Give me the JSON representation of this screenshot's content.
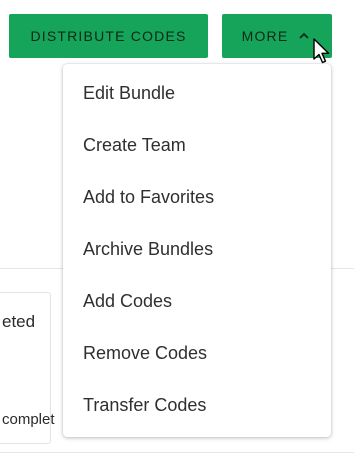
{
  "toolbar": {
    "distribute_label": "DISTRIBUTE CODES",
    "more_label": "MORE"
  },
  "background": {
    "status_text_1": "eted",
    "status_text_2": "complet"
  },
  "more_menu": {
    "items": [
      "Edit Bundle",
      "Create Team",
      "Add to Favorites",
      "Archive Bundles",
      "Add Codes",
      "Remove Codes",
      "Transfer Codes"
    ]
  },
  "icons": {
    "more_toggle": "chevron-up-icon",
    "pointer": "mouse-cursor-icon"
  },
  "colors": {
    "accent": "#16a35a",
    "button_text": "#0c2a17"
  }
}
